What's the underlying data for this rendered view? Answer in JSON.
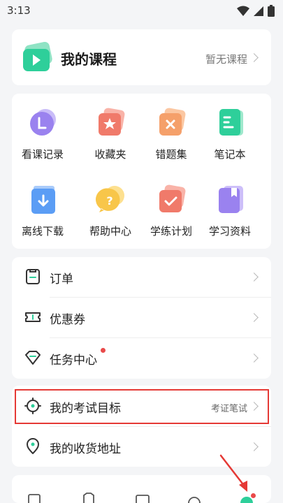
{
  "status_bar": {
    "time": "3:13"
  },
  "course": {
    "title": "我的课程",
    "status": "暂无课程"
  },
  "grid": [
    {
      "label": "看课记录",
      "icon": "clock-icon"
    },
    {
      "label": "收藏夹",
      "icon": "star-folder-icon"
    },
    {
      "label": "错题集",
      "icon": "wrong-question-icon"
    },
    {
      "label": "笔记本",
      "icon": "notebook-icon"
    },
    {
      "label": "离线下载",
      "icon": "download-icon"
    },
    {
      "label": "帮助中心",
      "icon": "help-icon"
    },
    {
      "label": "学练计划",
      "icon": "plan-check-icon"
    },
    {
      "label": "学习资料",
      "icon": "materials-icon"
    }
  ],
  "menu1": [
    {
      "label": "订单",
      "icon": "order-icon"
    },
    {
      "label": "优惠券",
      "icon": "coupon-icon"
    },
    {
      "label": "任务中心",
      "icon": "task-icon",
      "badge": true
    }
  ],
  "menu2": [
    {
      "label": "我的考试目标",
      "value": "考证笔试",
      "icon": "target-icon"
    },
    {
      "label": "我的收货地址",
      "icon": "location-icon"
    }
  ],
  "colors": {
    "accent_green": "#2ecf9a",
    "purple": "#9a82ef",
    "coral": "#f07a6a",
    "orange": "#f5a06a",
    "blue": "#5b9df5",
    "yellow": "#f8c64a",
    "highlight_red": "#e53935"
  }
}
